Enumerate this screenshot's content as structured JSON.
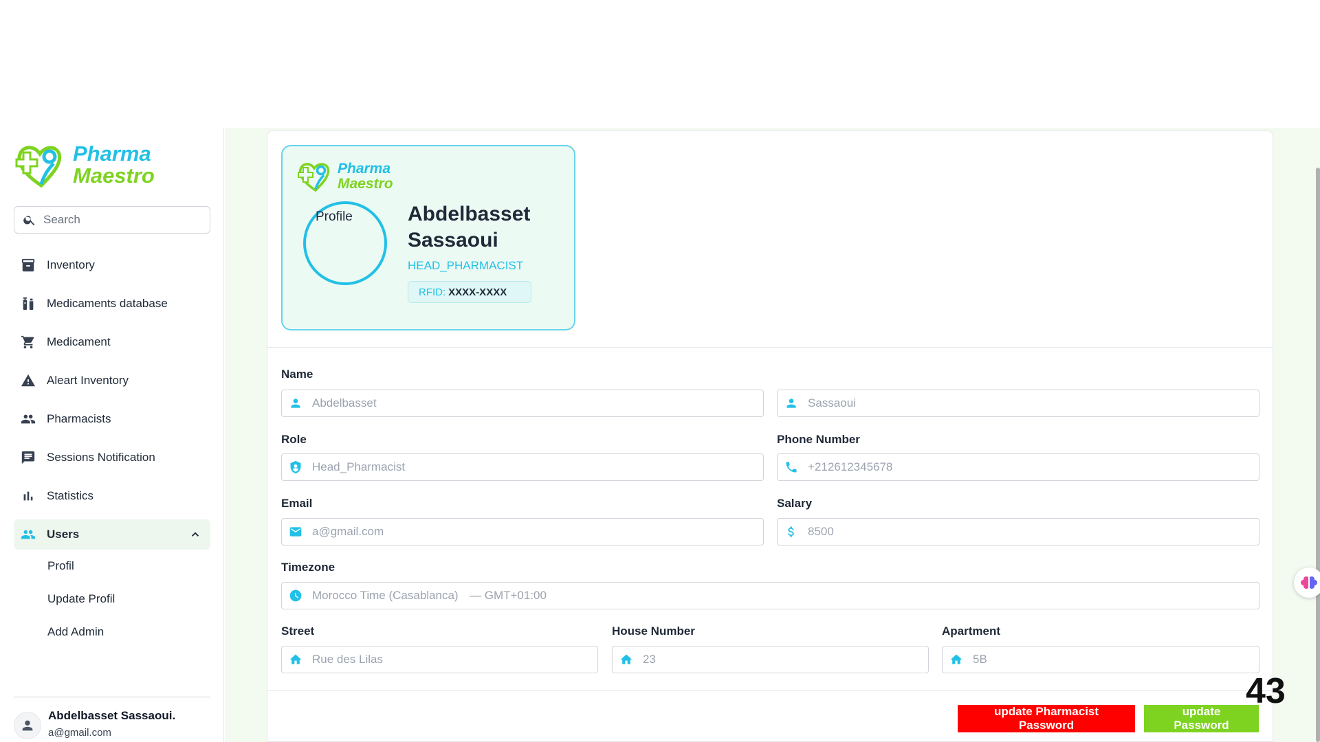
{
  "brand": {
    "name_line1": "Pharma",
    "name_line2": "Maestro",
    "green": "#7ed321",
    "cyan": "#22c0e6"
  },
  "search": {
    "placeholder": "Search"
  },
  "sidebar": {
    "items": [
      {
        "label": "Inventory",
        "icon": "archive-icon"
      },
      {
        "label": "Medicaments database",
        "icon": "medicine-icon"
      },
      {
        "label": "Medicament",
        "icon": "cart-icon"
      },
      {
        "label": "Aleart Inventory",
        "icon": "warning-icon"
      },
      {
        "label": "Pharmacists",
        "icon": "people-icon"
      },
      {
        "label": "Sessions Notification",
        "icon": "chat-icon"
      },
      {
        "label": "Statistics",
        "icon": "bar-chart-icon"
      }
    ],
    "active": {
      "label": "Users",
      "icon": "people-icon"
    },
    "sub_items": [
      {
        "label": "Profil"
      },
      {
        "label": "Update Profil"
      },
      {
        "label": "Add Admin"
      }
    ]
  },
  "footer_user": {
    "name": "Abdelbasset Sassaoui.",
    "email": "a@gmail.com"
  },
  "profile_card": {
    "image_alt": "Profile",
    "name": "Abdelbasset Sassaoui",
    "role": "HEAD_PHARMACIST",
    "rfid_label": "RFID:",
    "rfid_value": "XXXX-XXXX"
  },
  "form": {
    "name_label": "Name",
    "first_name": "Abdelbasset",
    "last_name": "Sassaoui",
    "role_label": "Role",
    "role": "Head_Pharmacist",
    "phone_label": "Phone Number",
    "phone": "+212612345678",
    "email_label": "Email",
    "email": "a@gmail.com",
    "salary_label": "Salary",
    "salary": "8500",
    "timezone_label": "Timezone",
    "timezone": "Morocco Time (Casablanca)",
    "timezone_offset": "— GMT+01:00",
    "street_label": "Street",
    "street": "Rue des Lilas",
    "house_label": "House Number",
    "house": "23",
    "apartment_label": "Apartment",
    "apartment": "5B"
  },
  "buttons": {
    "update_pharmacist_password": "update Pharmacist Password",
    "update_password": "update Password"
  },
  "page_number": "43"
}
